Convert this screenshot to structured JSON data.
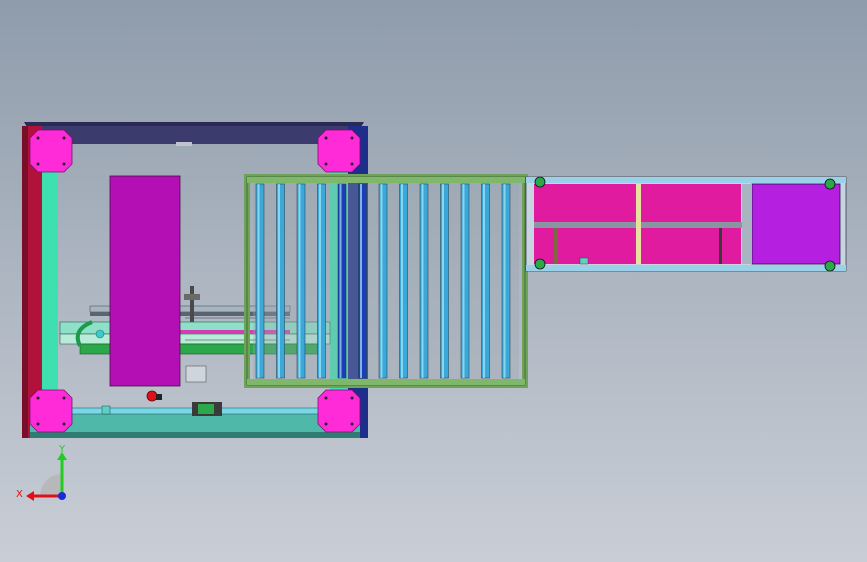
{
  "triad": {
    "x_label": "X",
    "y_label": "Y"
  },
  "colors": {
    "background_top": "#8f9cab",
    "background_bottom": "#c9ced6",
    "frame_top": "#3b3b6e",
    "frame_left": "#b0123a",
    "frame_right": "#1d2f8a",
    "frame_bottom": "#4fb8a8",
    "corner_block": "#ff2ad8",
    "rail_cyan": "#3fe0b0",
    "plate_magenta": "#b40fb4",
    "roller_frame": "#6fa35a",
    "roller": "#3aa8d8",
    "roller_blue": "#1c3fb8",
    "side_panel": "#e01ba0",
    "side_panel_violet": "#b41fe0",
    "axis_x": "#e0101a",
    "axis_y": "#22cc22",
    "axis_z": "#1a2ad8"
  },
  "icons": [
    "view-triad-icon"
  ]
}
